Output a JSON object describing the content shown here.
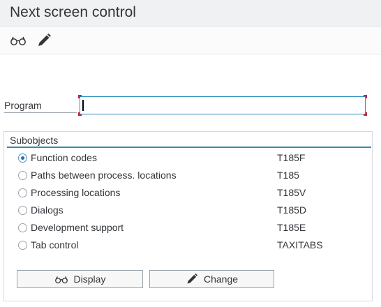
{
  "window": {
    "title": "Next screen control"
  },
  "toolbar": {
    "display_icon": "glasses-icon",
    "change_icon": "pencil-icon"
  },
  "program": {
    "label": "Program",
    "value": ""
  },
  "subobjects": {
    "title": "Subobjects",
    "selected_index": 0,
    "options": [
      {
        "label": "Function codes",
        "code": "T185F"
      },
      {
        "label": "Paths between process. locations",
        "code": "T185"
      },
      {
        "label": "Processing locations",
        "code": "T185V"
      },
      {
        "label": "Dialogs",
        "code": "T185D"
      },
      {
        "label": "Development support",
        "code": "T185E"
      },
      {
        "label": "Tab control",
        "code": "TAXITABS"
      }
    ]
  },
  "buttons": {
    "display_label": "Display",
    "change_label": "Change"
  },
  "colors": {
    "accent": "#3a87b6",
    "required_marker": "#c8223c",
    "title_bar": "#f0f1f2"
  }
}
